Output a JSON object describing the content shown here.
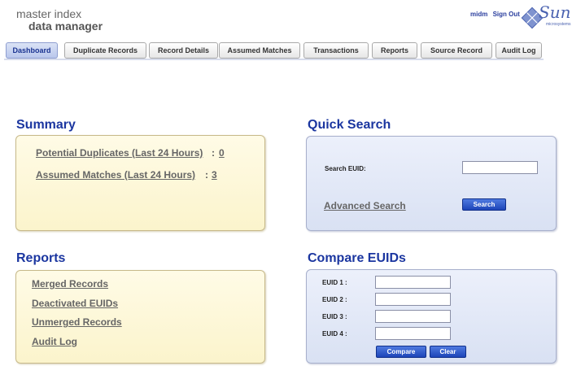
{
  "header": {
    "logo_line1": "master index",
    "logo_line2": "data manager",
    "user": "midm",
    "signout": "Sign Out",
    "sun_word": "Sun",
    "sun_sub": "microsystems"
  },
  "tabs": [
    {
      "label": "Dashboard",
      "active": true
    },
    {
      "label": "Duplicate Records"
    },
    {
      "label": "Record Details"
    },
    {
      "label": "Assumed Matches"
    },
    {
      "label": "Transactions"
    },
    {
      "label": "Reports"
    },
    {
      "label": "Source Record"
    },
    {
      "label": "Audit Log"
    }
  ],
  "summary": {
    "title": "Summary",
    "potential_label": "Potential Duplicates (Last 24 Hours)",
    "potential_value": "0",
    "assumed_label": "Assumed Matches (Last 24 Hours)",
    "assumed_value": "3",
    "colon": ":"
  },
  "quick_search": {
    "title": "Quick Search",
    "euid_label": "Search EUID:",
    "euid_value": "",
    "advanced": "Advanced Search",
    "search_button": "Search"
  },
  "reports": {
    "title": "Reports",
    "items": [
      "Merged Records",
      "Deactivated EUIDs",
      "Unmerged Records",
      "Audit Log"
    ]
  },
  "compare": {
    "title": "Compare EUIDs",
    "labels": [
      "EUID 1 :",
      "EUID 2 :",
      "EUID 3 :",
      "EUID 4 :"
    ],
    "values": [
      "",
      "",
      "",
      ""
    ],
    "compare_button": "Compare",
    "clear_button": "Clear"
  },
  "colors": {
    "title_blue": "#1b36a0",
    "link_gray": "#666666",
    "button_blue": "#1d45b8",
    "yellow_panel": "#fbf4cc",
    "blue_panel": "#d9e1f3"
  }
}
